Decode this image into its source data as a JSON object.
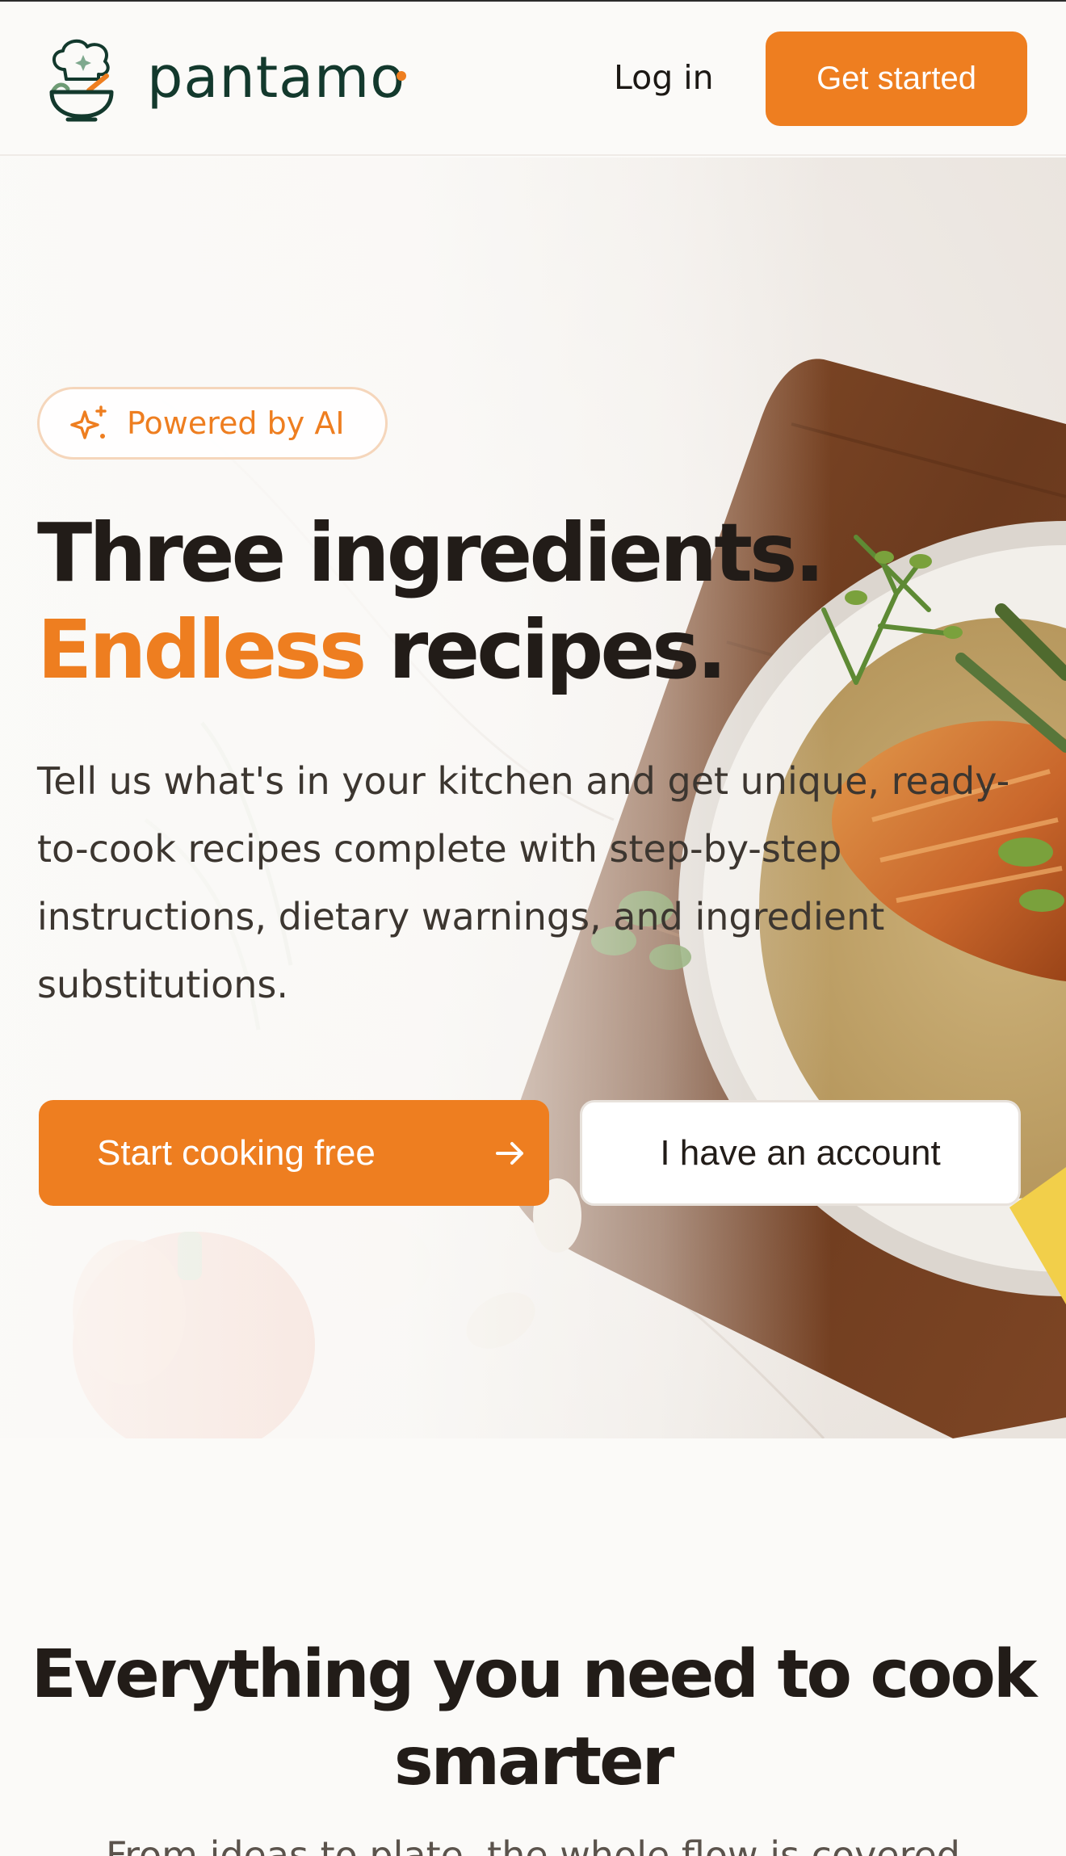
{
  "header": {
    "logo_text": "pantamo",
    "login_label": "Log in",
    "get_started_label": "Get started"
  },
  "hero": {
    "badge_label": "Powered by AI",
    "headline_line1": "Three ingredients.",
    "headline_accent": "Endless",
    "headline_rest": " recipes.",
    "description": "Tell us what's in your kitchen and get unique, ready-to-cook recipes complete with step-by-step instructions, dietary warnings, and ingredient substitutions.",
    "primary_cta_label": "Start cooking free",
    "secondary_cta_label": "I have an account"
  },
  "features": {
    "title": "Everything you need to cook smarter",
    "subtitle_partial": "From ideas to plate, the whole flow is covered"
  },
  "colors": {
    "accent": "#ee7e20",
    "brand_green": "#13392d",
    "text_dark": "#221c18",
    "background": "#fbfaf8"
  },
  "icons": {
    "logo": "chef-hat-bowl-icon",
    "badge": "sparkles-icon",
    "cta": "arrow-right-icon"
  }
}
